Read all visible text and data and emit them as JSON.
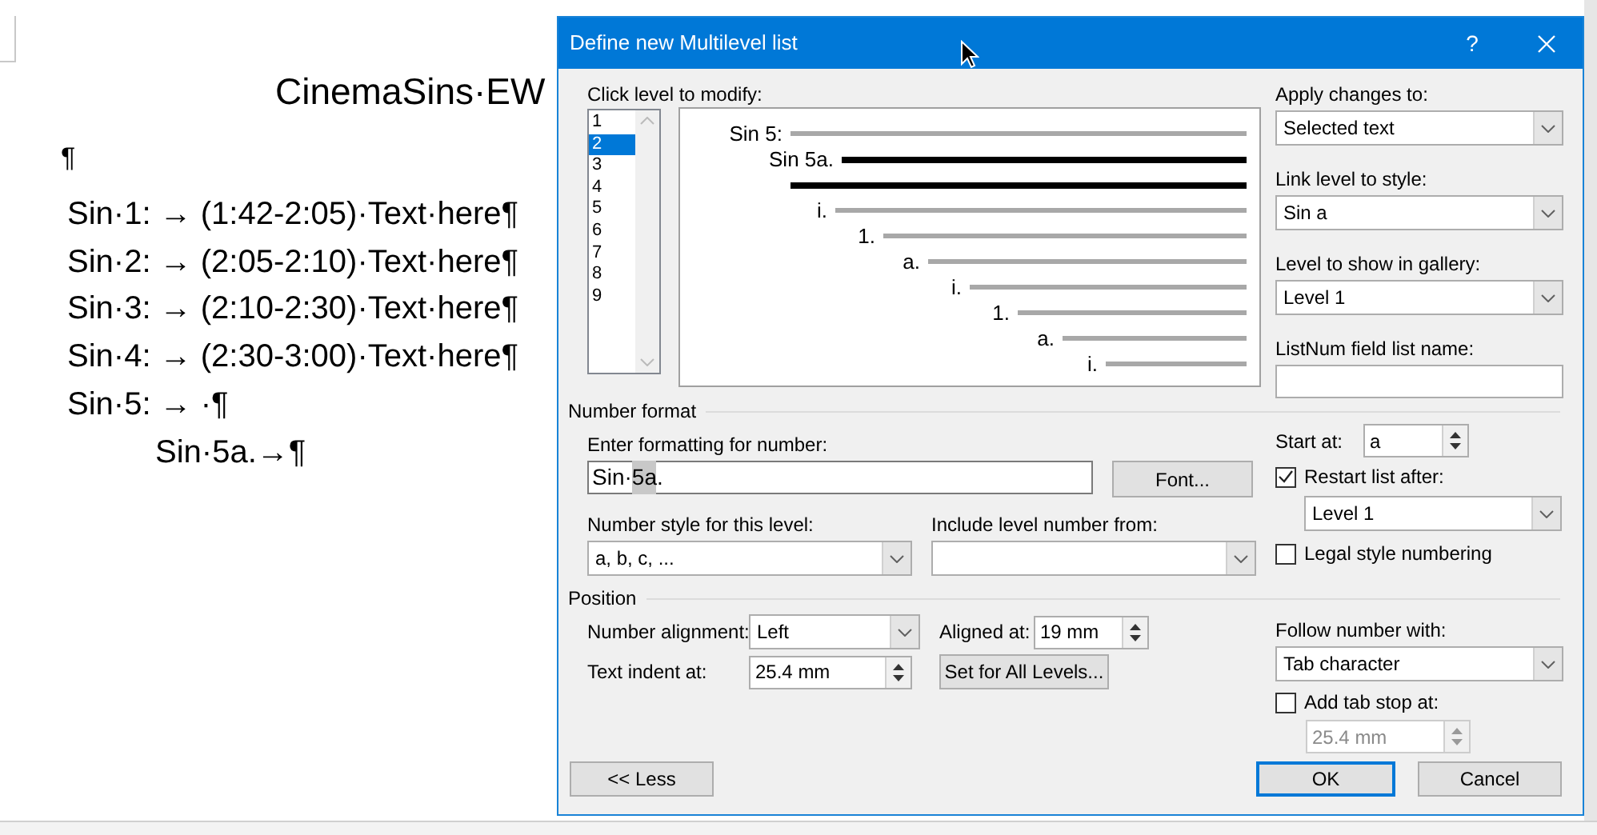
{
  "document": {
    "title": "CinemaSins·EW",
    "lines": [
      {
        "text": "¶"
      },
      {
        "text": "Sin·1: → (1:42-2:05)·Text·here¶"
      },
      {
        "text": "Sin·2: → (2:05-2:10)·Text·here¶"
      },
      {
        "text": "Sin·3: → (2:10-2:30)·Text·here¶"
      },
      {
        "text": "Sin·4: → (2:30-3:00)·Text·here¶"
      },
      {
        "text": "Sin·5: → ·¶",
        "children": [
          {
            "text": "Sin·5a.→¶"
          }
        ]
      }
    ]
  },
  "dialog": {
    "title": "Define new Multilevel list",
    "help_button": "?",
    "level_list": {
      "label": "Click level to modify:",
      "items": [
        {
          "label": "1",
          "selected": false
        },
        {
          "label": "2",
          "selected": true
        },
        {
          "label": "3",
          "selected": false
        },
        {
          "label": "4",
          "selected": false
        },
        {
          "label": "5",
          "selected": false
        },
        {
          "label": "6",
          "selected": false
        },
        {
          "label": "7",
          "selected": false
        },
        {
          "label": "8",
          "selected": false
        },
        {
          "label": "9",
          "selected": false
        }
      ]
    },
    "preview": {
      "rows": [
        {
          "label": "Sin 5:",
          "highlighted": false
        },
        {
          "label": "Sin 5a.",
          "highlighted": true
        },
        {
          "label": "",
          "highlighted": true
        },
        {
          "label": "i.",
          "highlighted": false
        },
        {
          "label": "1.",
          "highlighted": false
        },
        {
          "label": "a.",
          "highlighted": false
        },
        {
          "label": "i.",
          "highlighted": false
        },
        {
          "label": "1.",
          "highlighted": false
        },
        {
          "label": "a.",
          "highlighted": false
        },
        {
          "label": "i.",
          "highlighted": false
        }
      ]
    },
    "apply_changes": {
      "label": "Apply changes to:",
      "value": "Selected text"
    },
    "link_level": {
      "label": "Link level to style:",
      "value": "Sin a"
    },
    "gallery_level": {
      "label": "Level to show in gallery:",
      "value": "Level 1"
    },
    "listnum_name": {
      "label": "ListNum field list name:"
    },
    "number_format": {
      "heading": "Number format",
      "format_label": "Enter formatting for number:",
      "format_parts": [
        {
          "text": "Sin·",
          "selected": false
        },
        {
          "text": "5a",
          "selected": true
        },
        {
          "text": ".",
          "selected": false
        }
      ],
      "font_button": "Font...",
      "style_label": "Number style for this level:",
      "style_value": "a, b, c, ...",
      "include_label": "Include level number from:"
    },
    "start_at": {
      "label": "Start at:",
      "value": "a"
    },
    "restart": {
      "label": "Restart list after:",
      "checked": true,
      "value": "Level 1"
    },
    "legal": {
      "label": "Legal style numbering",
      "checked": false
    },
    "position": {
      "heading": "Position",
      "alignment_label": "Number alignment:",
      "alignment_value": "Left",
      "aligned_label": "Aligned at:",
      "aligned_value": "19 mm",
      "indent_label": "Text indent at:",
      "indent_value": "25.4 mm",
      "set_all_button": "Set for All Levels..."
    },
    "follow": {
      "label": "Follow number with:",
      "value": "Tab character"
    },
    "tab_stop": {
      "label": "Add tab stop at:",
      "checked": false,
      "value": "25.4 mm",
      "disabled": true
    },
    "buttons": [
      {
        "kind": "less",
        "label": "<< Less",
        "default": false
      },
      {
        "kind": "ok",
        "label": "OK",
        "default": true
      },
      {
        "kind": "cancel",
        "label": "Cancel",
        "default": false
      }
    ]
  }
}
